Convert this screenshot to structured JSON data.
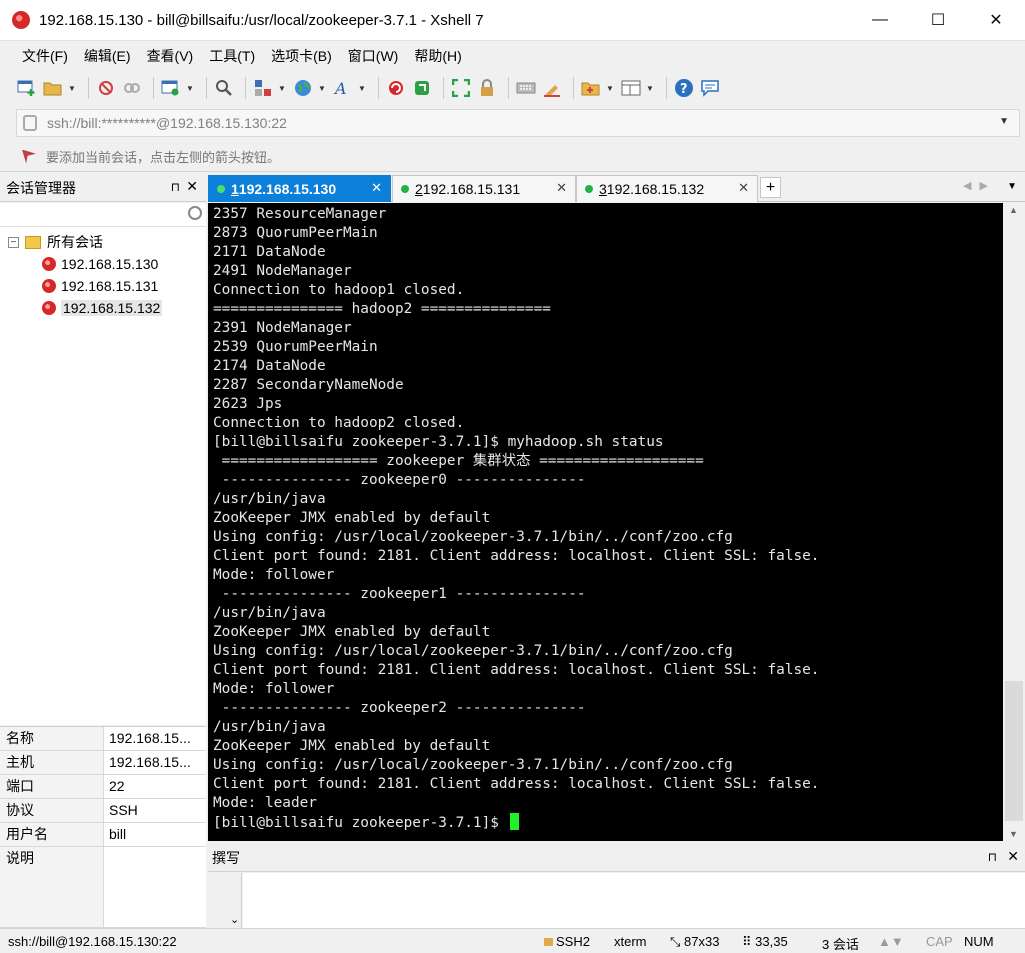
{
  "window": {
    "title": "192.168.15.130 - bill@billsaifu:/usr/local/zookeeper-3.7.1 - Xshell 7",
    "minimize": "—",
    "maximize": "☐",
    "close": "✕"
  },
  "menu": [
    "文件(F)",
    "编辑(E)",
    "查看(V)",
    "工具(T)",
    "选项卡(B)",
    "窗口(W)",
    "帮助(H)"
  ],
  "address": {
    "value": "ssh://bill:**********@192.168.15.130:22"
  },
  "hint": {
    "text": "要添加当前会话，点击左侧的箭头按钮。"
  },
  "session_manager": {
    "title": "会话管理器",
    "pin": "⊓",
    "close": "✕",
    "tree_root": "所有会话",
    "tree_toggle": "−",
    "sessions": [
      "192.168.15.130",
      "192.168.15.131",
      "192.168.15.132"
    ],
    "properties": [
      {
        "key": "名称",
        "value": "192.168.15..."
      },
      {
        "key": "主机",
        "value": "192.168.15..."
      },
      {
        "key": "端口",
        "value": "22"
      },
      {
        "key": "协议",
        "value": "SSH"
      },
      {
        "key": "用户名",
        "value": "bill"
      },
      {
        "key": "说明",
        "value": ""
      }
    ]
  },
  "tabs": [
    {
      "num": "1",
      "label": " 192.168.15.130",
      "active": true
    },
    {
      "num": "2",
      "label": " 192.168.15.131",
      "active": false
    },
    {
      "num": "3",
      "label": " 192.168.15.132",
      "active": false
    }
  ],
  "tab_close": "✕",
  "tab_add": "+",
  "terminal_lines": [
    "2357 ResourceManager",
    "2873 QuorumPeerMain",
    "2171 DataNode",
    "2491 NodeManager",
    "Connection to hadoop1 closed.",
    "=============== hadoop2 ===============",
    "2391 NodeManager",
    "2539 QuorumPeerMain",
    "2174 DataNode",
    "2287 SecondaryNameNode",
    "2623 Jps",
    "Connection to hadoop2 closed.",
    "[bill@billsaifu zookeeper-3.7.1]$ myhadoop.sh status",
    " ================== zookeeper 集群状态 ===================",
    " --------------- zookeeper0 ---------------",
    "/usr/bin/java",
    "ZooKeeper JMX enabled by default",
    "Using config: /usr/local/zookeeper-3.7.1/bin/../conf/zoo.cfg",
    "Client port found: 2181. Client address: localhost. Client SSL: false.",
    "Mode: follower",
    " --------------- zookeeper1 ---------------",
    "/usr/bin/java",
    "ZooKeeper JMX enabled by default",
    "Using config: /usr/local/zookeeper-3.7.1/bin/../conf/zoo.cfg",
    "Client port found: 2181. Client address: localhost. Client SSL: false.",
    "Mode: follower",
    " --------------- zookeeper2 ---------------",
    "/usr/bin/java",
    "ZooKeeper JMX enabled by default",
    "Using config: /usr/local/zookeeper-3.7.1/bin/../conf/zoo.cfg",
    "Client port found: 2181. Client address: localhost. Client SSL: false.",
    "Mode: leader",
    "[bill@billsaifu zookeeper-3.7.1]$ "
  ],
  "compose": {
    "title": "撰写",
    "pin": "⊓",
    "close": "✕",
    "expand": "⌄"
  },
  "status": {
    "connection": "ssh://bill@192.168.15.130:22",
    "protocol": "SSH2",
    "term": "xterm",
    "size": "87x33",
    "cursor": "33,35",
    "sessions": "3 会话",
    "caps": "CAP",
    "num": "NUM"
  },
  "colors": {
    "active_tab": "#0c7fd8",
    "connected_dot": "#21b24b",
    "cursor": "#1ef02d",
    "terminal_bg": "#000000",
    "terminal_fg": "#e6e6e6"
  }
}
